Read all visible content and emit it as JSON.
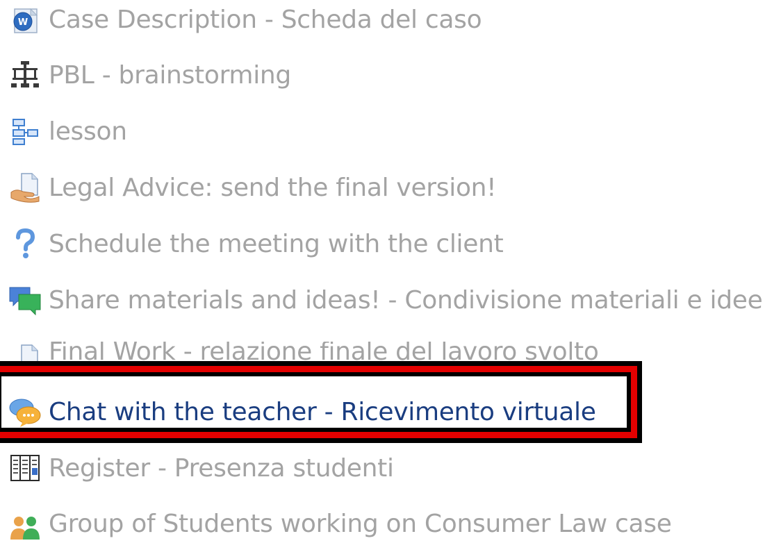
{
  "activities": [
    {
      "label": "Case Description - Scheda del caso",
      "icon": "word-document-icon"
    },
    {
      "label": "PBL - brainstorming",
      "icon": "brainstorm-icon"
    },
    {
      "label": "lesson",
      "icon": "lesson-icon"
    },
    {
      "label": "Legal Advice: send the final version!",
      "icon": "assignment-upload-icon"
    },
    {
      "label": "Schedule the meeting with the client",
      "icon": "question-mark-icon"
    },
    {
      "label": "Share materials and ideas! - Condivisione materiali e idee",
      "icon": "forum-icon"
    },
    {
      "label": "Final Work - relazione finale del lavoro svolto",
      "icon": "assignment-upload-icon"
    },
    {
      "label": "Chat with the teacher - Ricevimento virtuale",
      "icon": "chat-icon"
    },
    {
      "label": "Register - Presenza studenti",
      "icon": "register-icon"
    },
    {
      "label": "Group of Students working on Consumer Law case",
      "icon": "group-icon"
    }
  ],
  "highlight": {
    "target": "Chat with the teacher - Ricevimento virtuale",
    "colors": {
      "outer": "#000000",
      "inner": "#e40000"
    }
  },
  "colors": {
    "dimmed_text": "#a3a3a3",
    "active_link": "#1a3d80"
  }
}
